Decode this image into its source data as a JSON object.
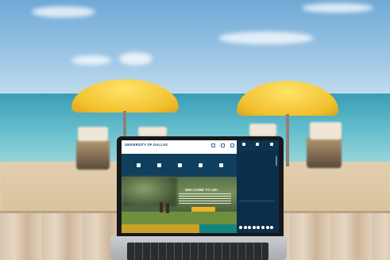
{
  "photo": {
    "subject": "laptop-on-beach-table",
    "colors": {
      "sky": "#9ac4e4",
      "sea": "#4fb0c4",
      "sand": "#dcc7a3",
      "umbrella": "#f2c12e",
      "table": "#dccab2"
    }
  },
  "website": {
    "logo": "UNIVERSITY OF DALLAS",
    "tagline": "",
    "header_icons": [
      "pencil-icon",
      "person-icon",
      "search-icon"
    ],
    "quicklinks": {
      "title": "",
      "items": [
        "",
        "",
        "",
        "",
        ""
      ],
      "icons": [
        "pencil-icon",
        "arrow-icon",
        "calendar-icon",
        "document-icon",
        "chat-icon"
      ]
    },
    "hero": {
      "title": "WELCOME TO UD!",
      "button": ""
    },
    "colors": {
      "navy": "#0f3b57",
      "gold": "#c9a227",
      "teal": "#13857c"
    },
    "side_menu": {
      "top": [
        "",
        "",
        ""
      ],
      "top_icons": [
        "home-icon",
        "filter-icon",
        "search-icon"
      ],
      "items": [
        "",
        "",
        "",
        "",
        "",
        "",
        "",
        "",
        "",
        ""
      ],
      "sub_items": [
        "",
        "",
        "",
        "",
        "",
        ""
      ],
      "social_count": 8
    }
  }
}
